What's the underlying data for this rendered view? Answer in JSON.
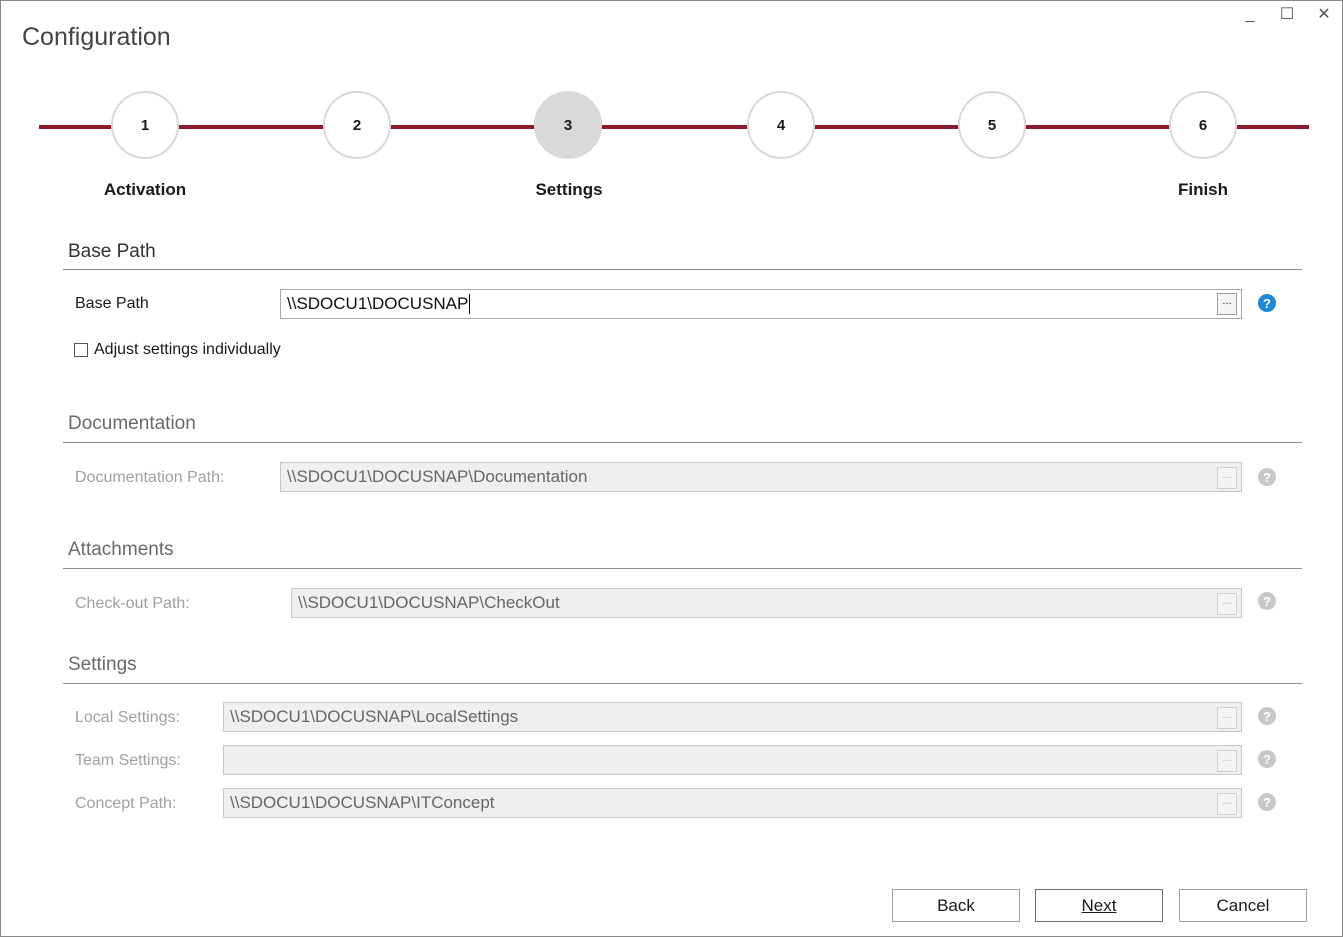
{
  "window": {
    "title": "Configuration",
    "minimize_glyph": "_",
    "maximize_glyph": "☐",
    "close_glyph": "✕"
  },
  "stepper": {
    "steps": [
      {
        "number": "1",
        "label": "Activation"
      },
      {
        "number": "2",
        "label": ""
      },
      {
        "number": "3",
        "label": "Settings",
        "active": true
      },
      {
        "number": "4",
        "label": ""
      },
      {
        "number": "5",
        "label": ""
      },
      {
        "number": "6",
        "label": "Finish"
      }
    ],
    "line_color": "#8e1b2e"
  },
  "base_path": {
    "section_title": "Base Path",
    "label": "Base Path",
    "value": "\\\\SDOCU1\\DOCUSNAP",
    "browse": "...",
    "help": "?",
    "adjust_checkbox_label": "Adjust settings individually",
    "adjust_checked": false
  },
  "documentation": {
    "section_title": "Documentation",
    "label": "Documentation Path:",
    "value": "\\\\SDOCU1\\DOCUSNAP\\Documentation",
    "browse": "...",
    "help": "?"
  },
  "attachments": {
    "section_title": "Attachments",
    "label": "Check-out Path:",
    "value": "\\\\SDOCU1\\DOCUSNAP\\CheckOut",
    "browse": "...",
    "help": "?"
  },
  "settings": {
    "section_title": "Settings",
    "local_label": "Local Settings:",
    "local_value": "\\\\SDOCU1\\DOCUSNAP\\LocalSettings",
    "team_label": "Team Settings:",
    "team_value": "",
    "concept_label": "Concept Path:",
    "concept_value": "\\\\SDOCU1\\DOCUSNAP\\ITConcept",
    "browse": "...",
    "help": "?"
  },
  "footer": {
    "back": "Back",
    "next": "Next",
    "cancel": "Cancel"
  },
  "colors": {
    "accent": "#8e1b2e",
    "help_active": "#1e88d6"
  }
}
